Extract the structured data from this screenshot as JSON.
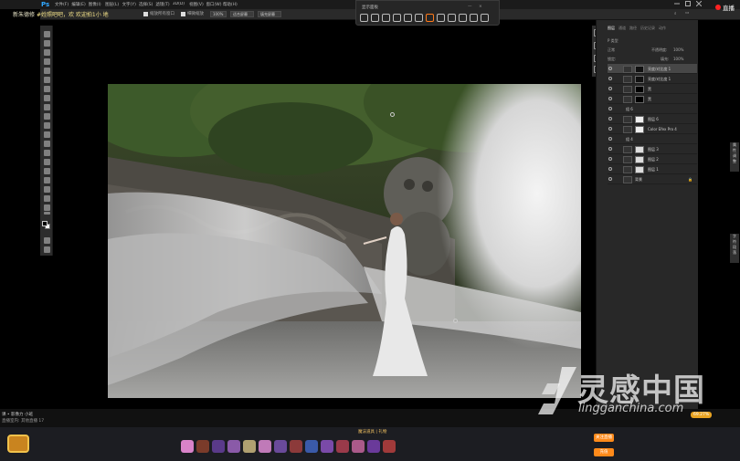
{
  "app": {
    "logo": "Ps"
  },
  "menus": [
    "文件(F)",
    "编辑(E)",
    "图像(I)",
    "图层(L)",
    "文字(Y)",
    "选择(S)",
    "滤镜(T)",
    "3D(D)",
    "视图(V)",
    "窗口(W)",
    "帮助(H)"
  ],
  "stream_overlay": {
    "prefix": "新朱德修",
    "highlight": "#姓照吧吧，欢 欢迎拍1小 地"
  },
  "options_bar": {
    "zoom_all": "缩放所有窗口",
    "scrubby": "细微缩放",
    "zoom_value": "100%",
    "fit_screen": "适合屏幕",
    "fill_screen": "填充屏幕"
  },
  "capture_bar": {
    "title": "显示面板",
    "ctl_min": "—",
    "ctl_close": "×"
  },
  "live_badge": {
    "label": "直播"
  },
  "right_panel": {
    "tabs": [
      "图层",
      "通道",
      "路径",
      "历史记录",
      "动作"
    ],
    "kind_label": "P 类型",
    "blend_mode": "正常",
    "opacity_label": "不透明度:",
    "opacity_value": "100%",
    "lock_label": "锁定:",
    "fill_label": "填充:",
    "fill_value": "100%",
    "layers": [
      {
        "name": "亮度/对比度 1",
        "selected": true
      },
      {
        "name": "亮度/对比度 1",
        "selected": false
      },
      {
        "name": "黑",
        "selected": false
      },
      {
        "name": "黑",
        "selected": false
      },
      {
        "name": "组 6",
        "selected": false
      },
      {
        "name": "图层 6",
        "selected": false
      },
      {
        "name": "Color Efex Pro 4",
        "selected": false
      },
      {
        "name": "组 4",
        "selected": false
      },
      {
        "name": "图层 3",
        "selected": false
      },
      {
        "name": "图层 2",
        "selected": false
      },
      {
        "name": "图层 1",
        "selected": false
      },
      {
        "name": "背景",
        "selected": false
      }
    ]
  },
  "side_panel_labels": {
    "upper": [
      "属",
      "性",
      "调",
      "整"
    ],
    "lower": [
      "字",
      "符",
      "段",
      "落"
    ]
  },
  "status": {
    "line1": "课 • 影像力 小班",
    "line2": "直播室内: 其他直播",
    "count": "17"
  },
  "gift_bar": {
    "label": "魔法道具",
    "sub": "礼物"
  },
  "buttons": {
    "upper": "关注直播",
    "lower": "充值"
  },
  "watermark": {
    "brand": "灵感中国",
    "domain": "lingganchina.com"
  },
  "zoom_status": {
    "pill": "69.27%"
  },
  "colors": {
    "accent_orange": "#ff8a1a",
    "live_red": "#ff2222",
    "ps_blue": "#31a8ff"
  }
}
